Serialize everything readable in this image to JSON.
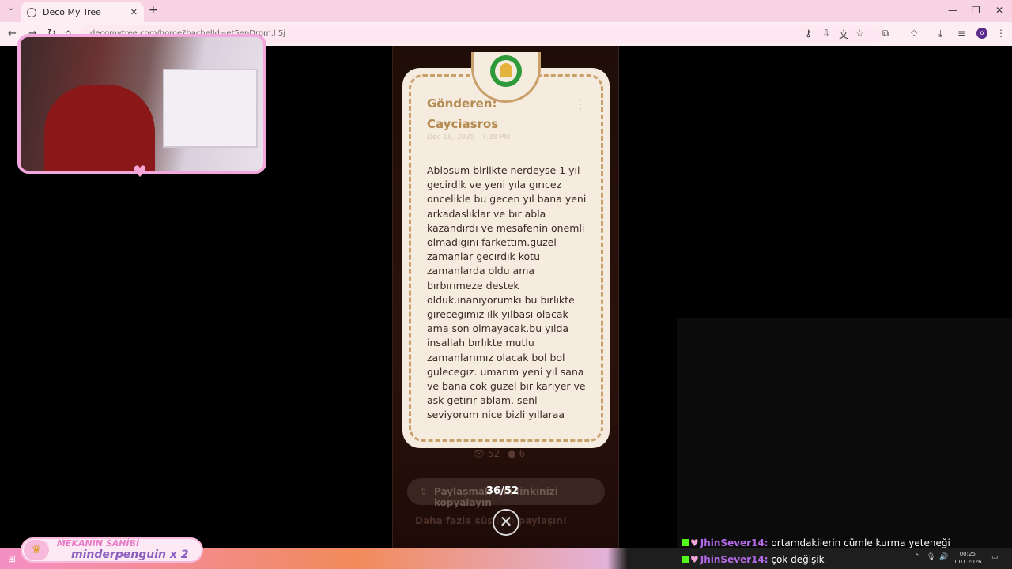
{
  "browser": {
    "tab_title": "Deco My Tree",
    "tab_close": "✕",
    "new_tab": "+",
    "url": "decomytree.com/home?bachelId=et5enDrom.l 5j",
    "minimize": "—",
    "maximize": "❐",
    "close": "✕",
    "back": "←",
    "forward": "→",
    "reload": "↻",
    "home": "⌂",
    "profile_initial": "o",
    "tabs_menu": "⌄"
  },
  "card": {
    "sender_label": "Gönderen:",
    "sender_name": "Cayciasros",
    "date": "Dec 18, 2025 · 7:38 PM",
    "kebab": "⋮",
    "message": "Ablosum birlikte nerdeyse 1 yıl gecirdik ve yeni yıla gırıcez oncelikle bu gecen yıl bana yeni arkadaslıklar ve bır abla kazandırdı ve mesafenin onemli olmadıgını farkettım.guzel zamanlar gecırdık kotu zamanlarda oldu ama bırbırımeze destek olduk.ınanıyorumkı bu bırlıkte gırecegımız ılk yılbası olacak ama son olmayacak.bu yılda insallah bırlıkte mutlu zamanlarımız olacak bol bol gulecegız. umarım yeni yıl sana ve bana cok guzel bır karıyer ve ask getırır ablam. seni seviyorum nice bizli yıllaraa"
  },
  "stats": {
    "views": "52",
    "likes": "6"
  },
  "share_button": {
    "label": "Paylaşmak için linkinizi kopyalayın"
  },
  "counter": "36/52",
  "more_text": "Daha fazla süs için paylaşın!",
  "close_symbol": "✕",
  "overlay": {
    "owner_title": "MEKANIN SAHİBİ",
    "owner_name": "minderpenguin x 2"
  },
  "chat": [
    {
      "user": "JhinSever14:",
      "message": "ortamdakilerin cümle kurma yeteneği"
    },
    {
      "user": "JhinSever14:",
      "message": "çok değişik"
    }
  ],
  "clock": {
    "time": "00:25",
    "date": "1.01.2026"
  }
}
